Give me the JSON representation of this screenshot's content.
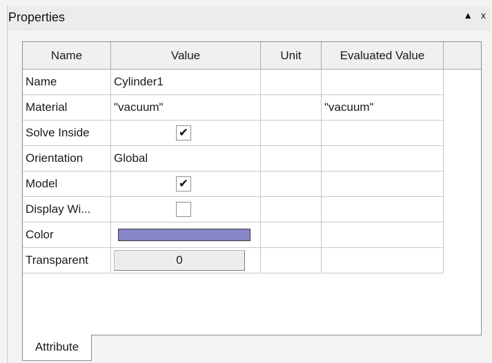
{
  "panel": {
    "title": "Properties",
    "pin_glyph": "▲",
    "close_glyph": "x"
  },
  "grid": {
    "columns": [
      "Name",
      "Value",
      "Unit",
      "Evaluated Value"
    ],
    "rows": [
      {
        "name": "Name",
        "value": "Cylinder1",
        "unit": "",
        "evaluated": ""
      },
      {
        "name": "Material",
        "value": "\"vacuum\"",
        "unit": "",
        "evaluated": "\"vacuum\""
      },
      {
        "name": "Solve Inside",
        "value_type": "checkbox",
        "checked": true,
        "check_glyph": "✔",
        "unit": "",
        "evaluated": ""
      },
      {
        "name": "Orientation",
        "value": "Global",
        "unit": "",
        "evaluated": ""
      },
      {
        "name": "Model",
        "value_type": "checkbox",
        "checked": true,
        "check_glyph": "✔",
        "unit": "",
        "evaluated": ""
      },
      {
        "name": "Display Wi...",
        "value_type": "checkbox",
        "checked": false,
        "unit": "",
        "evaluated": ""
      },
      {
        "name": "Color",
        "value_type": "color",
        "color": "#8686c8",
        "unit": "",
        "evaluated": ""
      },
      {
        "name": "Transparent",
        "value_type": "button",
        "value": "0",
        "unit": "",
        "evaluated": ""
      }
    ]
  },
  "tabs": [
    "Attribute"
  ]
}
